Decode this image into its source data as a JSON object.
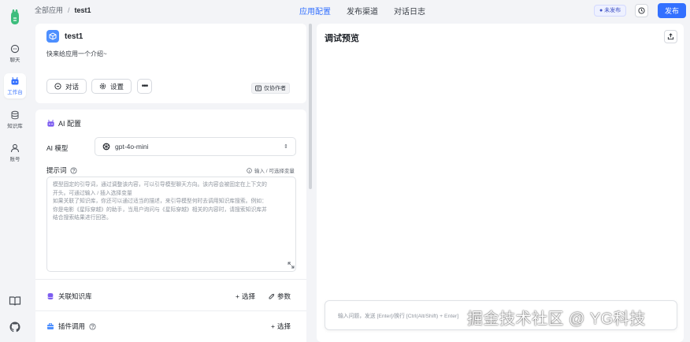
{
  "rail": {
    "items": [
      {
        "label": "聊天",
        "icon": "chat-icon"
      },
      {
        "label": "工作台",
        "icon": "robot-icon",
        "active": true
      },
      {
        "label": "知识库",
        "icon": "database-icon"
      },
      {
        "label": "账号",
        "icon": "user-icon"
      }
    ]
  },
  "header": {
    "crumb_root": "全部应用",
    "crumb_sep": "/",
    "crumb_current": "test1",
    "tabs": [
      "应用配置",
      "发布渠道",
      "对话日志"
    ],
    "status": "● 未发布",
    "publish": "发布"
  },
  "app": {
    "name": "test1",
    "desc": "快来给应用一个介绍~",
    "chat_btn": "对话",
    "settings_btn": "设置",
    "more": "•••",
    "collab": "仅协作者"
  },
  "config": {
    "section_title": "AI 配置",
    "model_label": "AI 模型",
    "model_value": "gpt-4o-mini",
    "prompt_label": "提示词",
    "var_hint": "输入 / 可选择变量",
    "prompt_placeholder": [
      "模型固定的引导词，通过调整该内容，可以引导模型聊天方向。该内容会被固定在上下文的",
      "开头。可通过输入 / 插入选择变量",
      "如果关联了知识库，你还可以通过适当的描述，来引导模型何时去调用知识库搜索。例如：",
      "你是电影《星际穿越》的助手，当用户询问与《星际穿越》相关的内容时，请搜索知识库并",
      "结合搜索结果进行回答。"
    ],
    "kb_title": "关联知识库",
    "kb_select": "选择",
    "kb_params": "参数",
    "plugin_title": "插件调用",
    "plugin_select": "选择"
  },
  "preview": {
    "title": "调试预览",
    "input_placeholder": "输入问题，发送 [Enter]/换行 [Ctrl(Alt/Shift) + Enter]"
  },
  "watermark": "掘金技术社区 @ YG科技",
  "colors": {
    "accent": "#3370ff",
    "logo": "#3dbd7d"
  }
}
